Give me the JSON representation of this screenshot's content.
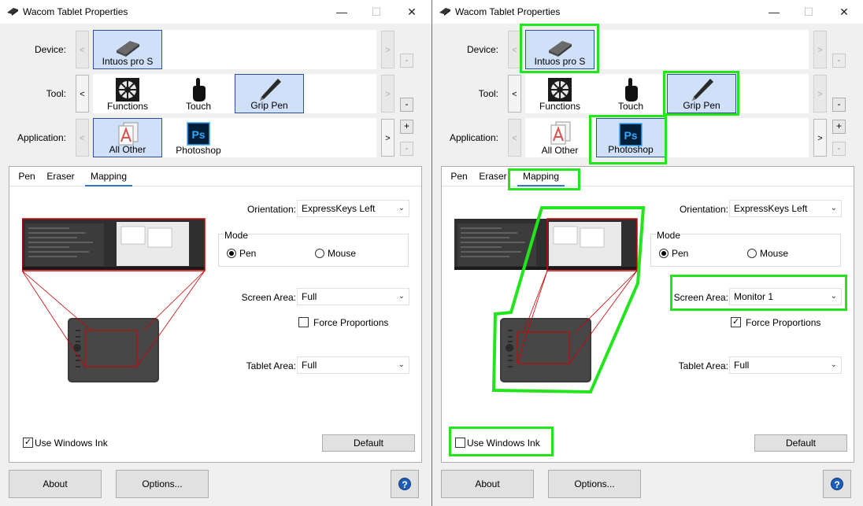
{
  "windows": [
    {
      "id": "left",
      "title": "Wacom Tablet Properties",
      "device_label": "Device:",
      "tool_label": "Tool:",
      "application_label": "Application:",
      "devices": [
        {
          "label": "Intuos pro S",
          "icon": "tablet-icon",
          "selected": true
        }
      ],
      "tools": [
        {
          "label": "Functions",
          "icon": "functions-icon",
          "selected": false
        },
        {
          "label": "Touch",
          "icon": "touch-hand-icon",
          "selected": false
        },
        {
          "label": "Grip Pen",
          "icon": "pen-icon",
          "selected": true
        }
      ],
      "applications": [
        {
          "label": "All Other",
          "icon": "all-other-icon",
          "selected": true
        },
        {
          "label": "Photoshop",
          "icon": "photoshop-icon",
          "selected": false
        }
      ],
      "tabs": [
        {
          "label": "Pen",
          "active": false
        },
        {
          "label": "Eraser",
          "active": false
        },
        {
          "label": "Mapping",
          "active": true
        }
      ],
      "orientation_label": "Orientation:",
      "orientation_value": "ExpressKeys Left",
      "mode_title": "Mode",
      "mode_pen": "Pen",
      "mode_mouse": "Mouse",
      "mode_selected": "pen",
      "screen_area_label": "Screen Area:",
      "screen_area_value": "Full",
      "force_proportions_label": "Force Proportions",
      "force_proportions_checked": false,
      "tablet_area_label": "Tablet Area:",
      "tablet_area_value": "Full",
      "use_windows_ink_label": "Use Windows Ink",
      "use_windows_ink_checked": true,
      "default_button": "Default",
      "about_button": "About",
      "options_button": "Options...",
      "help_glyph": "?",
      "plus_glyph": "+",
      "minus_glyph": "-",
      "arrow_left": "<",
      "arrow_right": ">",
      "minimize_glyph": "—",
      "maximize_glyph": "☐",
      "close_glyph": "✕",
      "highlights": false
    },
    {
      "id": "right",
      "title": "Wacom Tablet Properties",
      "device_label": "Device:",
      "tool_label": "Tool:",
      "application_label": "Application:",
      "devices": [
        {
          "label": "Intuos pro S",
          "icon": "tablet-icon",
          "selected": true
        }
      ],
      "tools": [
        {
          "label": "Functions",
          "icon": "functions-icon",
          "selected": false
        },
        {
          "label": "Touch",
          "icon": "touch-hand-icon",
          "selected": false
        },
        {
          "label": "Grip Pen",
          "icon": "pen-icon",
          "selected": true
        }
      ],
      "applications": [
        {
          "label": "All Other",
          "icon": "all-other-icon",
          "selected": false
        },
        {
          "label": "Photoshop",
          "icon": "photoshop-icon",
          "selected": true
        }
      ],
      "tabs": [
        {
          "label": "Pen",
          "active": false
        },
        {
          "label": "Eraser",
          "active": false
        },
        {
          "label": "Mapping",
          "active": true
        }
      ],
      "orientation_label": "Orientation:",
      "orientation_value": "ExpressKeys Left",
      "mode_title": "Mode",
      "mode_pen": "Pen",
      "mode_mouse": "Mouse",
      "mode_selected": "pen",
      "screen_area_label": "Screen Area:",
      "screen_area_value": "Monitor 1",
      "force_proportions_label": "Force Proportions",
      "force_proportions_checked": true,
      "tablet_area_label": "Tablet Area:",
      "tablet_area_value": "Full",
      "use_windows_ink_label": "Use Windows Ink",
      "use_windows_ink_checked": false,
      "default_button": "Default",
      "about_button": "About",
      "options_button": "Options...",
      "help_glyph": "?",
      "plus_glyph": "+",
      "minus_glyph": "-",
      "arrow_left": "<",
      "arrow_right": ">",
      "minimize_glyph": "—",
      "maximize_glyph": "☐",
      "close_glyph": "✕",
      "highlights": true
    }
  ],
  "colors": {
    "selection_fill": "#cfe0f8",
    "selection_border": "#2c4fa0",
    "highlight_green": "#22e51c",
    "mapping_red": "#d00000",
    "photoshop_blue": "#001e36",
    "photoshop_text": "#31a8ff",
    "help_blue": "#1e5eb8"
  }
}
